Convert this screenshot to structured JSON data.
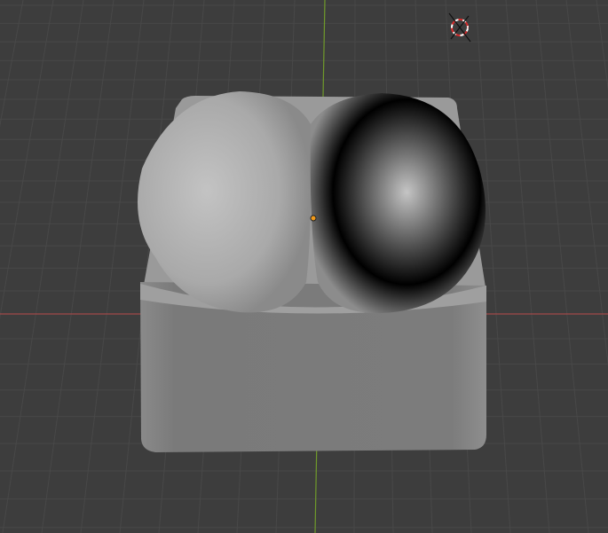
{
  "viewport": {
    "background_color": "#3d3d3d",
    "grid_color": "#484848",
    "x_axis_color": "#a14a4a",
    "y_axis_color": "#6f9a2a",
    "object_color": "#8f8f8f",
    "origin_color": "#f29a1a"
  },
  "icons": {
    "cursor": "3d-cursor-icon",
    "origin": "object-origin-icon"
  }
}
